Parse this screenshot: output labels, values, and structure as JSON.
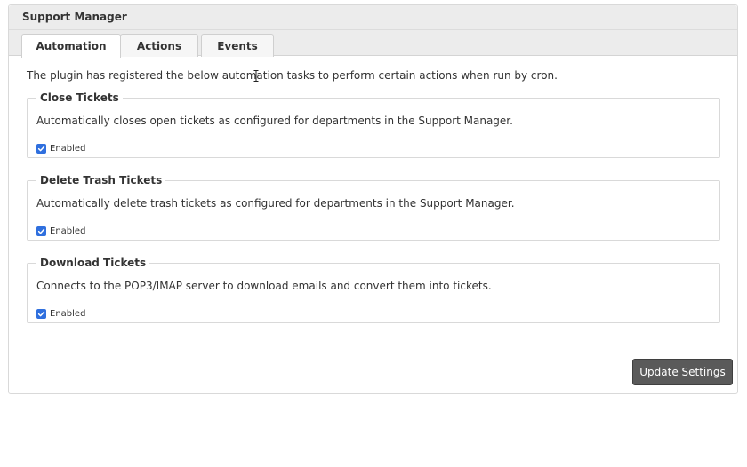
{
  "panel": {
    "title": "Support Manager"
  },
  "tabs": [
    {
      "label": "Automation",
      "active": true
    },
    {
      "label": "Actions",
      "active": false
    },
    {
      "label": "Events",
      "active": false
    }
  ],
  "intro": "The plugin has registered the below automation tasks to perform certain actions when run by cron.",
  "tasks": [
    {
      "title": "Close Tickets",
      "description": "Automatically closes open tickets as configured for departments in the Support Manager.",
      "checkbox_label": "Enabled",
      "checked": true
    },
    {
      "title": "Delete Trash Tickets",
      "description": "Automatically delete trash tickets as configured for departments in the Support Manager.",
      "checkbox_label": "Enabled",
      "checked": true
    },
    {
      "title": "Download Tickets",
      "description": "Connects to the POP3/IMAP server to download emails and convert them into tickets.",
      "checkbox_label": "Enabled",
      "checked": true
    }
  ],
  "buttons": {
    "update_label": "Update Settings"
  },
  "colors": {
    "accent": "#2f6fde",
    "button_bg": "#5a5a5a",
    "header_bg": "#ececec"
  },
  "icons": {
    "checkbox": "checkmark-icon",
    "cursor": "text-cursor-icon"
  }
}
